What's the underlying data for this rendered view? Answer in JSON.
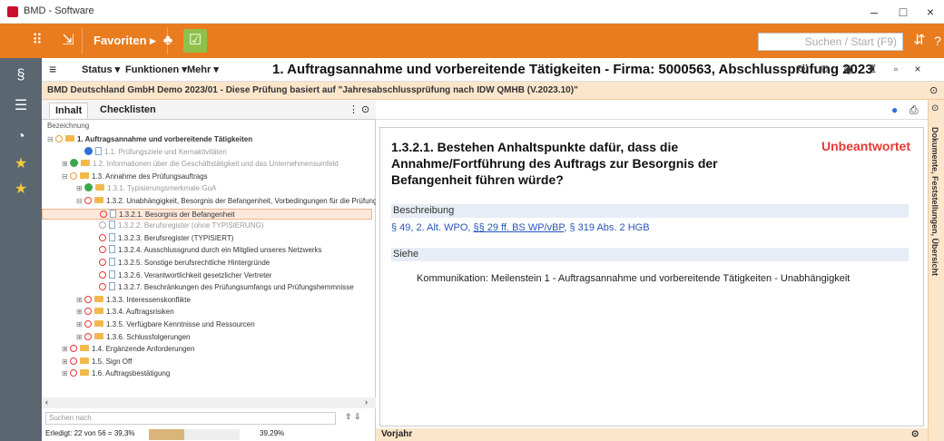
{
  "window": {
    "title": "BMD - Software",
    "minimize": "–",
    "maximize": "□",
    "close": "×"
  },
  "toolbar": {
    "favorites": "Favoriten",
    "search_placeholder": "Suchen / Start (F9)"
  },
  "menubar": {
    "status": "Status",
    "funktionen": "Funktionen",
    "mehr": "Mehr",
    "title": "1. Auftragsannahme und vorbereitende Tätigkeiten - Firma: 5000563, Abschlussprüfung 2023"
  },
  "infobar": {
    "text": "BMD Deutschland GmbH Demo 2023/01 - Diese Prüfung basiert auf \"Jahresabschlussprüfung nach IDW QMHB (V.2023.10)\""
  },
  "leftpanel": {
    "tab_inhalt": "Inhalt",
    "tab_checklisten": "Checklisten",
    "column_header": "Bezeichnung",
    "tree": [
      {
        "text": "1. Auftragsannahme und vorbereitende Tätigkeiten",
        "level": 0,
        "exp": "⊟",
        "icon": "ring-orange",
        "folder": true,
        "bold": true
      },
      {
        "text": "1.1. Prüfungsziele und Kernaktivitäten",
        "level": 2,
        "exp": "",
        "icon": "info",
        "folder": false,
        "muted": true
      },
      {
        "text": "1.2. Informationen über die Geschäftstätigkeit und das Unternehmensumfeld",
        "level": 1,
        "exp": "⊞",
        "icon": "ok",
        "folder": true,
        "muted": true
      },
      {
        "text": "1.3. Annahme des Prüfungsauftrags",
        "level": 1,
        "exp": "⊟",
        "icon": "ring-orange",
        "folder": true
      },
      {
        "text": "1.3.1. Typisierungsmerkmale GoA",
        "level": 2,
        "exp": "⊞",
        "icon": "ok",
        "folder": true,
        "muted": true
      },
      {
        "text": "1.3.2. Unabhängigkeit, Besorgnis der Befangenheit, Vorbedingungen für die Prüfung",
        "level": 2,
        "exp": "⊟",
        "icon": "ring",
        "folder": true
      },
      {
        "text": "1.3.2.1. Besorgnis der Befangenheit",
        "level": 3,
        "exp": "",
        "icon": "ring",
        "folder": false,
        "selected": true
      },
      {
        "text": "1.3.2.2. Berufsregister (ohne TYPISIERUNG)",
        "level": 3,
        "exp": "",
        "icon": "ring-grey",
        "folder": false,
        "muted": true
      },
      {
        "text": "1.3.2.3. Berufsregister (TYPISIERT)",
        "level": 3,
        "exp": "",
        "icon": "ring",
        "folder": false
      },
      {
        "text": "1.3.2.4. Ausschlussgrund durch ein Mitglied unseres Netzwerks",
        "level": 3,
        "exp": "",
        "icon": "ring",
        "folder": false
      },
      {
        "text": "1.3.2.5. Sonstige berufsrechtliche Hintergründe",
        "level": 3,
        "exp": "",
        "icon": "ring",
        "folder": false
      },
      {
        "text": "1.3.2.6. Verantwortlichkeit gesetzlicher Vertreter",
        "level": 3,
        "exp": "",
        "icon": "ring",
        "folder": false
      },
      {
        "text": "1.3.2.7. Beschränkungen des Prüfungsumfangs und Prüfungshemmnisse",
        "level": 3,
        "exp": "",
        "icon": "ring",
        "folder": false
      },
      {
        "text": "1.3.3. Interessenskonflikte",
        "level": 2,
        "exp": "⊞",
        "icon": "ring",
        "folder": true
      },
      {
        "text": "1.3.4. Auftragsrisiken",
        "level": 2,
        "exp": "⊞",
        "icon": "ring",
        "folder": true
      },
      {
        "text": "1.3.5. Verfügbare Kenntnisse und Ressourcen",
        "level": 2,
        "exp": "⊞",
        "icon": "ring",
        "folder": true
      },
      {
        "text": "1.3.6. Schlussfolgerungen",
        "level": 2,
        "exp": "⊞",
        "icon": "ring",
        "folder": true
      },
      {
        "text": "1.4. Ergänzende Anforderungen",
        "level": 1,
        "exp": "⊞",
        "icon": "ring",
        "folder": true
      },
      {
        "text": "1.5. Sign Off",
        "level": 1,
        "exp": "⊞",
        "icon": "ring",
        "folder": true
      },
      {
        "text": "1.6. Auftragsbestätigung",
        "level": 1,
        "exp": "⊞",
        "icon": "ring",
        "folder": true
      }
    ],
    "find_placeholder": "Suchen nach",
    "done_text": "Erledigt: 22 von 56 = 39,3%",
    "progress": 0.393,
    "progress_label": "39,29%"
  },
  "rightpanel": {
    "question": "1.3.2.1. Bestehen Anhaltspunkte dafür, dass die Annahme/Fortführung des Auftrags zur Besorgnis der Befangenheit führen würde?",
    "status": "Unbeantwortet",
    "beschreibung_label": "Beschreibung",
    "refs_pre": "§ 49, 2. Alt. WPO, ",
    "refs_link": "§§ 29 ff. BS WP/vBP",
    "refs_post": ", § 319 Abs. 2 HGB",
    "siehe_label": "Siehe",
    "siehe_text": "Kommunikation: Meilenstein 1 - Auftragsannahme und vorbereitende Tätigkeiten - Unabhängigkeit",
    "vorjahr": "Vorjahr"
  },
  "sidestrip": {
    "text": "Dokumente, Feststellungen, Übersicht"
  },
  "colors": {
    "accent": "#e87c1e",
    "sidebar": "#5a6670",
    "status": "#e53935",
    "info_bg": "#fbe6cc"
  }
}
